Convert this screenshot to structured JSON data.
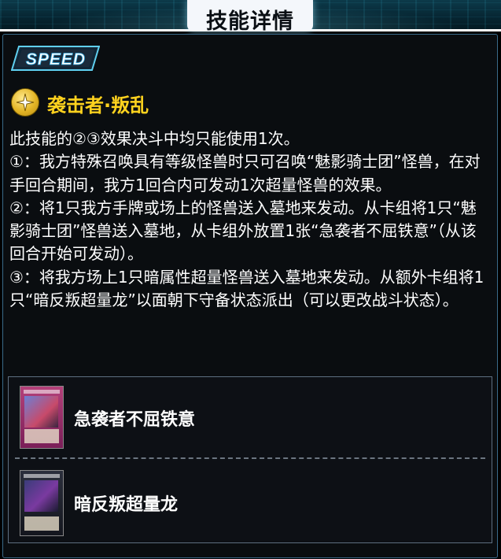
{
  "header": {
    "title": "技能详情"
  },
  "badge": {
    "label": "SPEED"
  },
  "skill": {
    "icon": "star-icon",
    "name": "袭击者·叛乱",
    "description": [
      "此技能的②③效果决斗中均只能使用1次。",
      "①：我方特殊召唤具有等级怪兽时只可召唤“魅影骑士团”怪兽，在对手回合期间，我方1回合内可发动1次超量怪兽的效果。",
      "②：将1只我方手牌或场上的怪兽送入墓地来发动。从卡组将1只“魅影骑士团”怪兽送入墓地，从卡组外放置1张“急袭者不屈铁意”（从该回合开始可发动）。",
      "③：将我方场上1只暗属性超量怪兽送入墓地来发动。从额外卡组将1只“暗反叛超量龙”以面朝下守备状态派出（可以更改战斗状态）。"
    ]
  },
  "related_cards": [
    {
      "name": "急袭者不屈铁意",
      "type": "trap"
    },
    {
      "name": "暗反叛超量龙",
      "type": "xyz"
    }
  ],
  "colors": {
    "accent": "#ffd21e",
    "panel_border": "#3a6a8a",
    "header_bg": "#0c3a4a"
  }
}
